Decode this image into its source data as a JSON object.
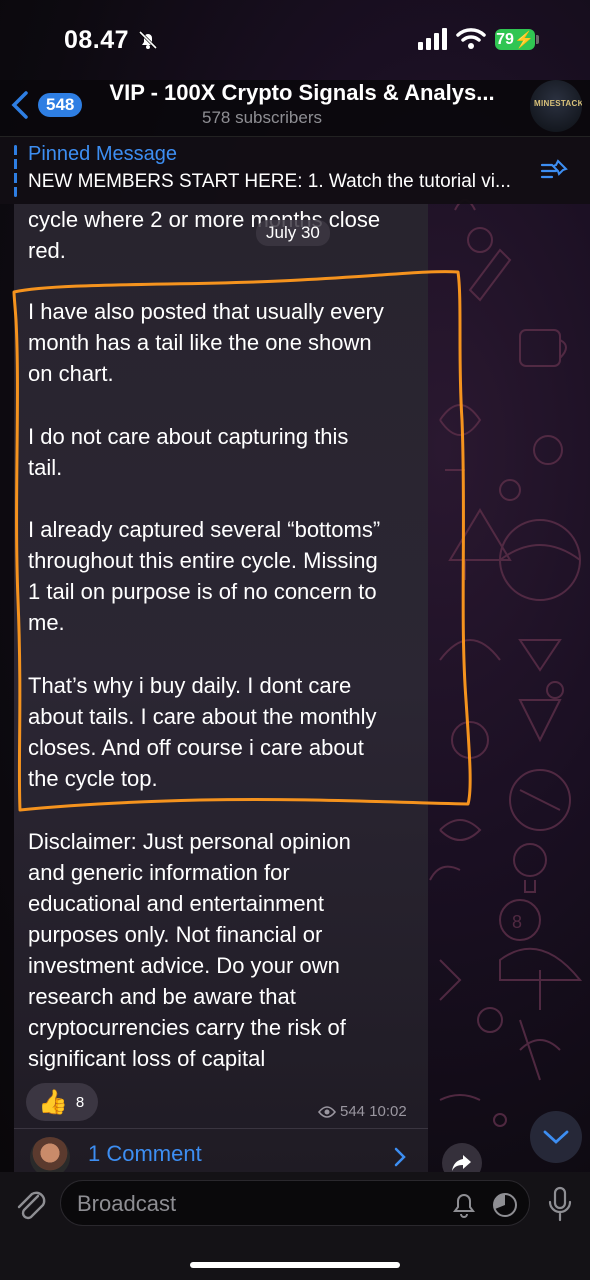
{
  "status_bar": {
    "time": "08.47",
    "battery": "79"
  },
  "header": {
    "back_count": "548",
    "title": "VIP - 100X Crypto Signals & Analys...",
    "subscribers": "578 subscribers",
    "avatar_text": "MINESTACK"
  },
  "pinned": {
    "title": "Pinned Message",
    "text": "NEW MEMBERS START HERE: 1. Watch the tutorial vi..."
  },
  "message": {
    "top_fragment": [
      "cycle where 2 or more months close",
      "red."
    ],
    "date_pill": "July 30",
    "highlighted_paragraphs": [
      [
        "I have also posted that usually every",
        "month has a tail like the one shown",
        "on chart."
      ],
      [
        "I do not care about capturing this",
        "tail."
      ],
      [
        "I already captured several “bottoms”",
        "throughout this entire cycle. Missing",
        "1 tail on purpose is of no concern to",
        "me."
      ],
      [
        "That’s why i buy daily. I dont care",
        "about tails. I care about the monthly",
        "closes. And off course i care about",
        "the cycle top."
      ]
    ],
    "disclaimer": [
      "Disclaimer: Just personal opinion",
      "and generic information for",
      "educational and entertainment",
      "purposes only. Not financial or",
      "investment advice. Do your own",
      "research and be aware that",
      "cryptocurrencies carry the risk of",
      "significant loss of capital"
    ],
    "reaction": {
      "emoji": "👍",
      "count": "8"
    },
    "views": "544",
    "time": "10:02",
    "comments_label": "1 Comment"
  },
  "composer": {
    "placeholder": "Broadcast"
  },
  "colors": {
    "accent": "#2e7ee3",
    "annotation": "#f5931e",
    "battery": "#30c552"
  },
  "icons": [
    "bell-slash-icon",
    "signal-icon",
    "wifi-icon",
    "battery-icon",
    "back-chevron-icon",
    "pin-list-icon",
    "eye-icon",
    "chevron-right-icon",
    "share-icon",
    "chevron-down-icon",
    "paperclip-icon",
    "bell-icon",
    "timer-icon",
    "mic-icon"
  ]
}
